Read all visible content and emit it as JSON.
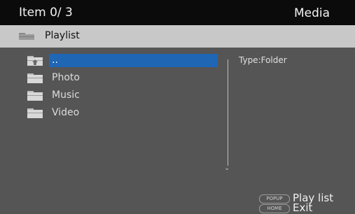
{
  "header": {
    "item_counter": "Item 0/ 3",
    "mode": "Media"
  },
  "path": {
    "label": "Playlist",
    "icon": "folder-icon"
  },
  "items": [
    {
      "label": "..",
      "icon": "folder-up-icon",
      "selected": true
    },
    {
      "label": "Photo",
      "icon": "folder-icon",
      "selected": false
    },
    {
      "label": "Music",
      "icon": "folder-icon",
      "selected": false
    },
    {
      "label": "Video",
      "icon": "folder-icon",
      "selected": false
    }
  ],
  "info": {
    "type_text": "Type:Folder"
  },
  "hints": [
    {
      "key": "POPUP",
      "action": "Play list"
    },
    {
      "key": "HOME",
      "action": "Exit"
    }
  ],
  "colors": {
    "background": "#555555",
    "header": "#0b0b0b",
    "pathbar": "#c8c8c8",
    "selection": "#1f66b5"
  }
}
